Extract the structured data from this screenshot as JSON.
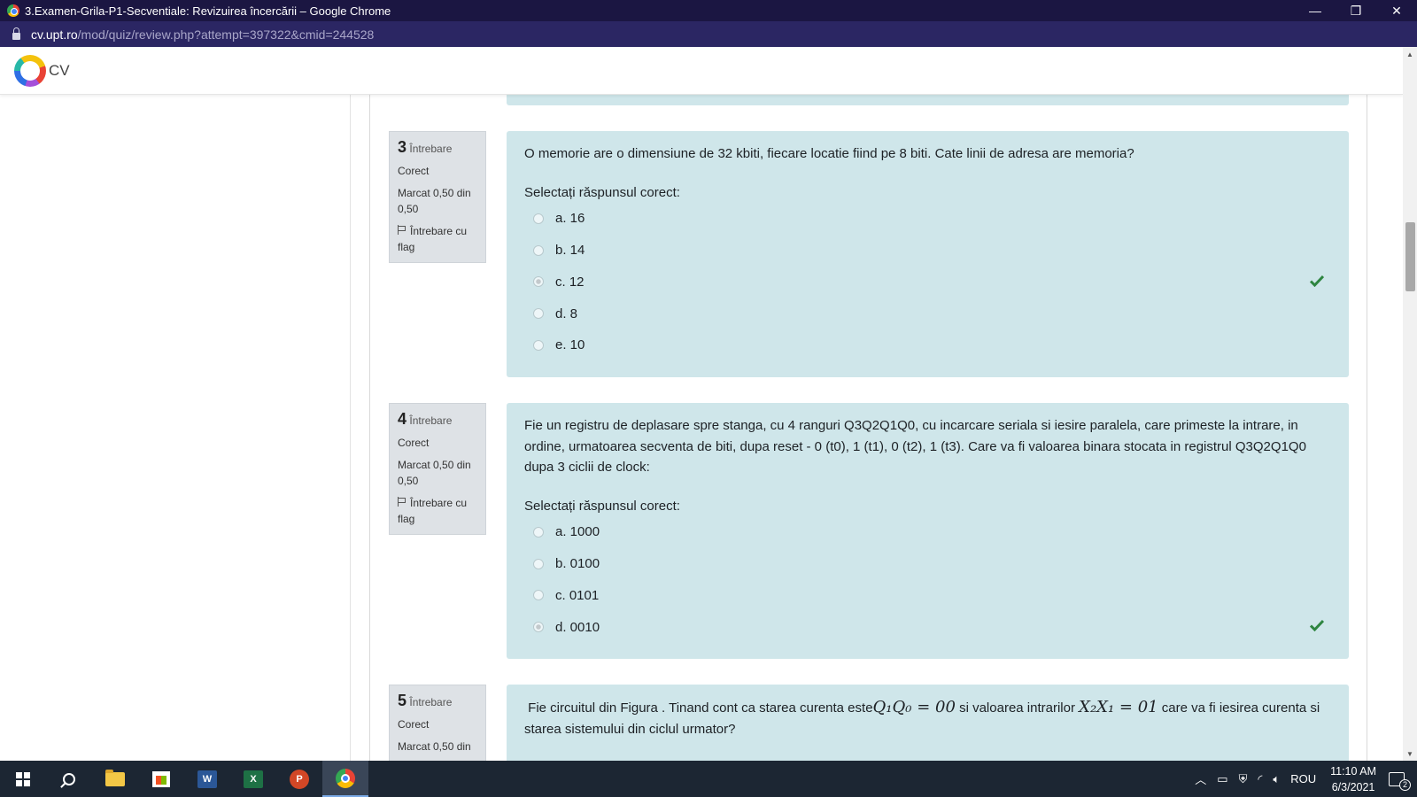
{
  "window": {
    "title": "3.Examen-Grila-P1-Secventiale: Revizuirea încercării – Google Chrome",
    "minimize_glyph": "—",
    "maximize_glyph": "❐",
    "close_glyph": "✕"
  },
  "address": {
    "domain": "cv.upt.ro",
    "path": "/mod/quiz/review.php?attempt=397322&cmid=244528"
  },
  "site": {
    "logo_text": "CV"
  },
  "colors": {
    "content_bg": "#cfe6ea",
    "info_bg": "#dee2e6",
    "check": "#2e8540",
    "titlebar": "#1b1642",
    "addressbar": "#2b2663"
  },
  "questions": [
    {
      "number": "3",
      "word": "Întrebare",
      "status": "Corect",
      "mark": "Marcat 0,50 din 0,50",
      "flag": "Întrebare cu flag",
      "text": "O memorie are o dimensiune de 32 kbiti, fiecare locatie fiind pe 8 biti. Cate linii de adresa are memoria?",
      "prompt": "Selectați răspunsul corect:",
      "answers": [
        {
          "label": "a. 16",
          "selected": false
        },
        {
          "label": "b. 14",
          "selected": false
        },
        {
          "label": "c. 12",
          "selected": true,
          "correct": true
        },
        {
          "label": "d. 8",
          "selected": false
        },
        {
          "label": "e. 10",
          "selected": false
        }
      ]
    },
    {
      "number": "4",
      "word": "Întrebare",
      "status": "Corect",
      "mark": "Marcat 0,50 din 0,50",
      "flag": "Întrebare cu flag",
      "text": "Fie un registru de deplasare spre stanga, cu 4 ranguri Q3Q2Q1Q0, cu incarcare seriala si iesire paralela, care primeste la intrare, in ordine, urmatoarea secventa de biti, dupa reset - 0 (t0), 1 (t1), 0 (t2), 1 (t3). Care va fi valoarea binara stocata in registrul Q3Q2Q1Q0 dupa 3 ciclii de clock:",
      "prompt": "Selectați răspunsul corect:",
      "answers": [
        {
          "label": "a. 1000",
          "selected": false
        },
        {
          "label": "b. 0100",
          "selected": false
        },
        {
          "label": "c. 0101",
          "selected": false
        },
        {
          "label": "d. 0010",
          "selected": true,
          "correct": true
        }
      ]
    },
    {
      "number": "5",
      "word": "Întrebare",
      "status": "Corect",
      "mark": "Marcat 0,50 din",
      "text_part1": "Fie circuitul din Figura . Tinand cont ca starea curenta este",
      "math1": "Q₁Q₀ = 00",
      "text_part2": " si valoarea intrarilor ",
      "math2": "X₂X₁ = 01",
      "text_part3": " care va fi iesirea curenta si starea sistemului din ciclul urmator?"
    }
  ],
  "taskbar": {
    "word_letter": "W",
    "excel_letter": "X",
    "ppt_letter": "P",
    "language": "ROU",
    "time": "11:10 AM",
    "date": "6/3/2021",
    "notification_count": "2"
  }
}
